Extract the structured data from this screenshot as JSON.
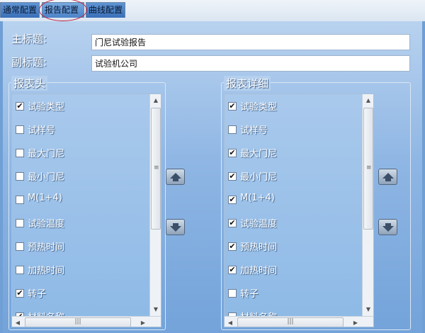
{
  "tabs": [
    {
      "label": "通常配置",
      "active": false
    },
    {
      "label": "报告配置",
      "active": true
    },
    {
      "label": "曲线配置",
      "active": false
    }
  ],
  "form": {
    "main_title_label": "主标题:",
    "main_title_value": "门尼试验报告",
    "sub_title_label": "副标题:",
    "sub_title_value": "试验机公司"
  },
  "header_group": {
    "title": "报表头",
    "items": [
      {
        "label": "试验类型",
        "checked": true
      },
      {
        "label": "试样号",
        "checked": false
      },
      {
        "label": "最大门尼",
        "checked": false
      },
      {
        "label": "最小门尼",
        "checked": false
      },
      {
        "label": "M(1+4)",
        "checked": false
      },
      {
        "label": "试验温度",
        "checked": false
      },
      {
        "label": "预热时间",
        "checked": false
      },
      {
        "label": "加热时间",
        "checked": false
      },
      {
        "label": "转子",
        "checked": true
      },
      {
        "label": "材料名称",
        "checked": true
      }
    ]
  },
  "detail_group": {
    "title": "报表详细",
    "items": [
      {
        "label": "试验类型",
        "checked": true
      },
      {
        "label": "试样号",
        "checked": false
      },
      {
        "label": "最大门尼",
        "checked": true
      },
      {
        "label": "最小门尼",
        "checked": true
      },
      {
        "label": "M(1+4)",
        "checked": true
      },
      {
        "label": "试验温度",
        "checked": true
      },
      {
        "label": "预热时间",
        "checked": true
      },
      {
        "label": "加热时间",
        "checked": true
      },
      {
        "label": "转子",
        "checked": false
      },
      {
        "label": "材料名称",
        "checked": false
      }
    ]
  },
  "icons": {
    "move_up": "move-up-icon",
    "move_down": "move-down-icon",
    "check": "✔"
  }
}
